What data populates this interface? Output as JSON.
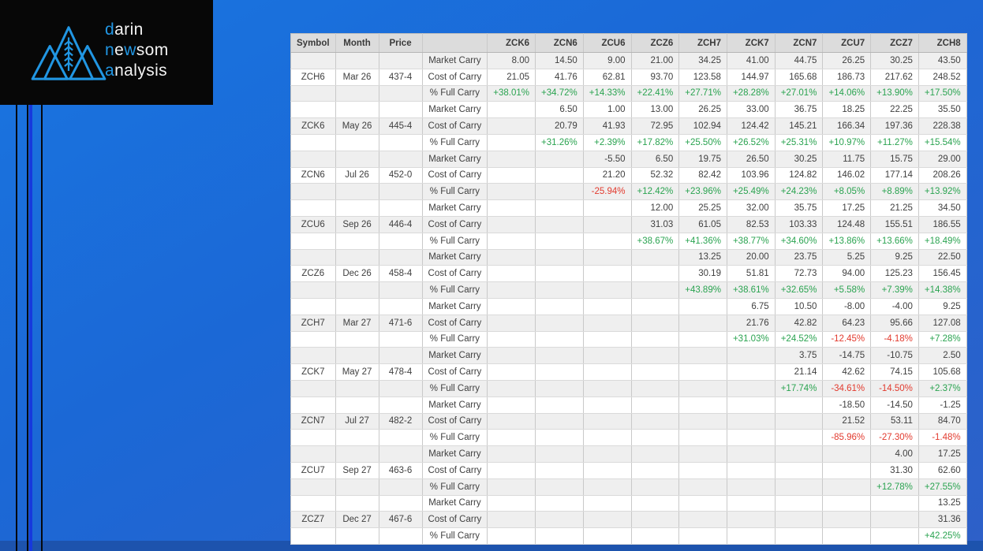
{
  "logo": {
    "accent_color": "#2196e3",
    "icon": "mountains-wheat-icon",
    "brand_lines": [
      {
        "parts": [
          {
            "text": "d",
            "accent": true
          },
          {
            "text": "arin",
            "accent": false
          }
        ]
      },
      {
        "parts": [
          {
            "text": "n",
            "accent": true
          },
          {
            "text": "e",
            "accent": false
          },
          {
            "text": "w",
            "accent": true
          },
          {
            "text": "som",
            "accent": false
          }
        ]
      },
      {
        "parts": [
          {
            "text": "a",
            "accent": true
          },
          {
            "text": "nalysis",
            "accent": false
          }
        ]
      }
    ]
  },
  "table": {
    "headers": [
      "Symbol",
      "Month",
      "Price",
      "",
      "ZCK6",
      "ZCN6",
      "ZCU6",
      "ZCZ6",
      "ZCH7",
      "ZCK7",
      "ZCN7",
      "ZCU7",
      "ZCZ7",
      "ZCH8"
    ],
    "row_labels": {
      "market": "Market Carry",
      "cost": "Cost of Carry",
      "pct": "% Full Carry"
    },
    "colors": {
      "positive": "#2aa350",
      "negative": "#e23a2e"
    },
    "groups": [
      {
        "symbol": "ZCH6",
        "month": "Mar 26",
        "price": "437-4",
        "market_carry": [
          "8.00",
          "14.50",
          "9.00",
          "21.00",
          "34.25",
          "41.00",
          "44.75",
          "26.25",
          "30.25",
          "43.50"
        ],
        "cost_of_carry": [
          "21.05",
          "41.76",
          "62.81",
          "93.70",
          "123.58",
          "144.97",
          "165.68",
          "186.73",
          "217.62",
          "248.52"
        ],
        "pct_full_carry": [
          "+38.01%",
          "+34.72%",
          "+14.33%",
          "+22.41%",
          "+27.71%",
          "+28.28%",
          "+27.01%",
          "+14.06%",
          "+13.90%",
          "+17.50%"
        ]
      },
      {
        "symbol": "ZCK6",
        "month": "May 26",
        "price": "445-4",
        "market_carry": [
          "",
          "6.50",
          "1.00",
          "13.00",
          "26.25",
          "33.00",
          "36.75",
          "18.25",
          "22.25",
          "35.50"
        ],
        "cost_of_carry": [
          "",
          "20.79",
          "41.93",
          "72.95",
          "102.94",
          "124.42",
          "145.21",
          "166.34",
          "197.36",
          "228.38"
        ],
        "pct_full_carry": [
          "",
          "+31.26%",
          "+2.39%",
          "+17.82%",
          "+25.50%",
          "+26.52%",
          "+25.31%",
          "+10.97%",
          "+11.27%",
          "+15.54%"
        ]
      },
      {
        "symbol": "ZCN6",
        "month": "Jul 26",
        "price": "452-0",
        "market_carry": [
          "",
          "",
          "-5.50",
          "6.50",
          "19.75",
          "26.50",
          "30.25",
          "11.75",
          "15.75",
          "29.00"
        ],
        "cost_of_carry": [
          "",
          "",
          "21.20",
          "52.32",
          "82.42",
          "103.96",
          "124.82",
          "146.02",
          "177.14",
          "208.26"
        ],
        "pct_full_carry": [
          "",
          "",
          "-25.94%",
          "+12.42%",
          "+23.96%",
          "+25.49%",
          "+24.23%",
          "+8.05%",
          "+8.89%",
          "+13.92%"
        ]
      },
      {
        "symbol": "ZCU6",
        "month": "Sep 26",
        "price": "446-4",
        "market_carry": [
          "",
          "",
          "",
          "12.00",
          "25.25",
          "32.00",
          "35.75",
          "17.25",
          "21.25",
          "34.50"
        ],
        "cost_of_carry": [
          "",
          "",
          "",
          "31.03",
          "61.05",
          "82.53",
          "103.33",
          "124.48",
          "155.51",
          "186.55"
        ],
        "pct_full_carry": [
          "",
          "",
          "",
          "+38.67%",
          "+41.36%",
          "+38.77%",
          "+34.60%",
          "+13.86%",
          "+13.66%",
          "+18.49%"
        ]
      },
      {
        "symbol": "ZCZ6",
        "month": "Dec 26",
        "price": "458-4",
        "market_carry": [
          "",
          "",
          "",
          "",
          "13.25",
          "20.00",
          "23.75",
          "5.25",
          "9.25",
          "22.50"
        ],
        "cost_of_carry": [
          "",
          "",
          "",
          "",
          "30.19",
          "51.81",
          "72.73",
          "94.00",
          "125.23",
          "156.45"
        ],
        "pct_full_carry": [
          "",
          "",
          "",
          "",
          "+43.89%",
          "+38.61%",
          "+32.65%",
          "+5.58%",
          "+7.39%",
          "+14.38%"
        ]
      },
      {
        "symbol": "ZCH7",
        "month": "Mar 27",
        "price": "471-6",
        "market_carry": [
          "",
          "",
          "",
          "",
          "",
          "6.75",
          "10.50",
          "-8.00",
          "-4.00",
          "9.25"
        ],
        "cost_of_carry": [
          "",
          "",
          "",
          "",
          "",
          "21.76",
          "42.82",
          "64.23",
          "95.66",
          "127.08"
        ],
        "pct_full_carry": [
          "",
          "",
          "",
          "",
          "",
          "+31.03%",
          "+24.52%",
          "-12.45%",
          "-4.18%",
          "+7.28%"
        ]
      },
      {
        "symbol": "ZCK7",
        "month": "May 27",
        "price": "478-4",
        "market_carry": [
          "",
          "",
          "",
          "",
          "",
          "",
          "3.75",
          "-14.75",
          "-10.75",
          "2.50"
        ],
        "cost_of_carry": [
          "",
          "",
          "",
          "",
          "",
          "",
          "21.14",
          "42.62",
          "74.15",
          "105.68"
        ],
        "pct_full_carry": [
          "",
          "",
          "",
          "",
          "",
          "",
          "+17.74%",
          "-34.61%",
          "-14.50%",
          "+2.37%"
        ]
      },
      {
        "symbol": "ZCN7",
        "month": "Jul 27",
        "price": "482-2",
        "market_carry": [
          "",
          "",
          "",
          "",
          "",
          "",
          "",
          "-18.50",
          "-14.50",
          "-1.25"
        ],
        "cost_of_carry": [
          "",
          "",
          "",
          "",
          "",
          "",
          "",
          "21.52",
          "53.11",
          "84.70"
        ],
        "pct_full_carry": [
          "",
          "",
          "",
          "",
          "",
          "",
          "",
          "-85.96%",
          "-27.30%",
          "-1.48%"
        ]
      },
      {
        "symbol": "ZCU7",
        "month": "Sep 27",
        "price": "463-6",
        "market_carry": [
          "",
          "",
          "",
          "",
          "",
          "",
          "",
          "",
          "4.00",
          "17.25"
        ],
        "cost_of_carry": [
          "",
          "",
          "",
          "",
          "",
          "",
          "",
          "",
          "31.30",
          "62.60"
        ],
        "pct_full_carry": [
          "",
          "",
          "",
          "",
          "",
          "",
          "",
          "",
          "+12.78%",
          "+27.55%"
        ]
      },
      {
        "symbol": "ZCZ7",
        "month": "Dec 27",
        "price": "467-6",
        "market_carry": [
          "",
          "",
          "",
          "",
          "",
          "",
          "",
          "",
          "",
          "13.25"
        ],
        "cost_of_carry": [
          "",
          "",
          "",
          "",
          "",
          "",
          "",
          "",
          "",
          "31.36"
        ],
        "pct_full_carry": [
          "",
          "",
          "",
          "",
          "",
          "",
          "",
          "",
          "",
          "+42.25%"
        ]
      }
    ]
  }
}
